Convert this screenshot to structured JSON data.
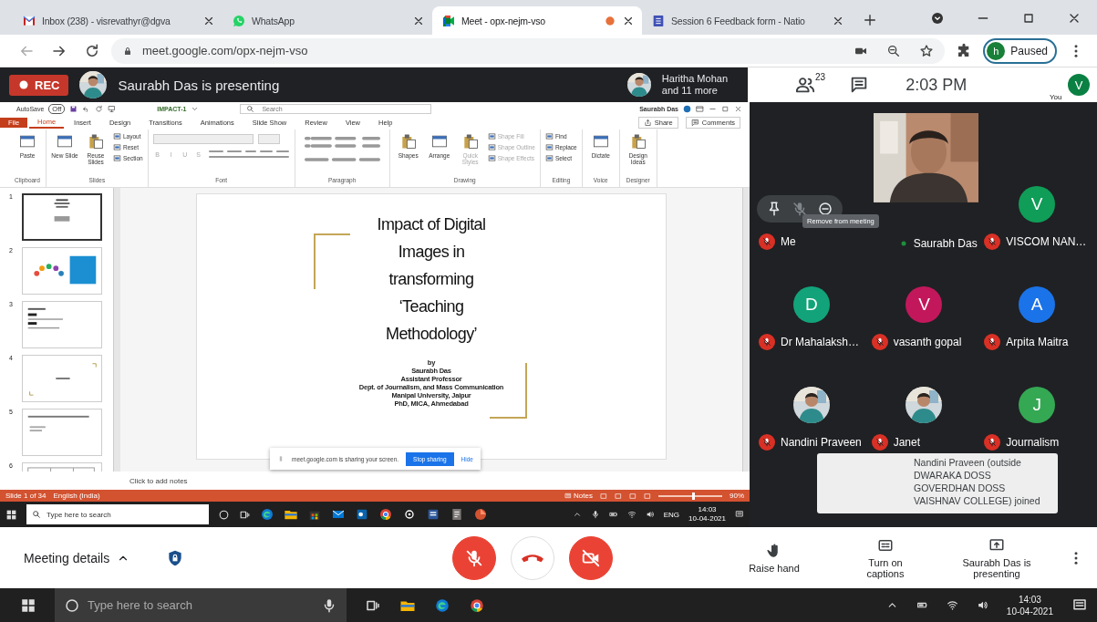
{
  "browser": {
    "tabs": [
      {
        "kind": "mail",
        "title": "Inbox (238) - visrevathyr@dgva",
        "selected": false,
        "recording": false
      },
      {
        "kind": "chat",
        "title": "WhatsApp",
        "selected": false,
        "recording": false
      },
      {
        "kind": "meet",
        "title": "Meet - opx-nejm-vso",
        "selected": true,
        "recording": true
      },
      {
        "kind": "form",
        "title": "Session 6 Feedback form - Natio",
        "selected": false,
        "recording": false
      }
    ],
    "url": "meet.google.com/opx-nejm-vso",
    "profile": {
      "initial": "h",
      "label": "Paused"
    }
  },
  "meet": {
    "rec": "REC",
    "presenter": "Saurabh Das is presenting",
    "others": [
      "Haritha Mohan",
      "and 11 more"
    ],
    "people_count": "23",
    "time": "2:03 PM",
    "self": {
      "initial": "V",
      "label": "You",
      "color": "#0b8043"
    }
  },
  "screen_share": {
    "titlebar": {
      "autosave": "AutoSave",
      "autosave_state": "Off",
      "file": "IMPACT-1",
      "search": "Search",
      "user": "Saurabh Das"
    },
    "ribbon_tabs": [
      {
        "label": "File",
        "kind": "file",
        "selected": false
      },
      {
        "label": "Home",
        "kind": "tab",
        "selected": true
      },
      {
        "label": "Insert",
        "kind": "tab",
        "selected": false
      },
      {
        "label": "Design",
        "kind": "tab",
        "selected": false
      },
      {
        "label": "Transitions",
        "kind": "tab",
        "selected": false
      },
      {
        "label": "Animations",
        "kind": "tab",
        "selected": false
      },
      {
        "label": "Slide Show",
        "kind": "tab",
        "selected": false
      },
      {
        "label": "Review",
        "kind": "tab",
        "selected": false
      },
      {
        "label": "View",
        "kind": "tab",
        "selected": false
      },
      {
        "label": "Help",
        "kind": "tab",
        "selected": false
      }
    ],
    "share": "Share",
    "comments": "Comments",
    "groups": [
      {
        "label": "Clipboard",
        "kind": "buttons",
        "buttons": [
          {
            "label": "Paste",
            "kind": "large",
            "disabled": false
          }
        ]
      },
      {
        "label": "Slides",
        "kind": "buttons",
        "buttons": [
          {
            "label": "New Slide",
            "kind": "large",
            "disabled": false
          },
          {
            "label": "Reuse Slides",
            "kind": "large",
            "disabled": false
          },
          {
            "label": "Layout",
            "kind": "small",
            "disabled": false
          },
          {
            "label": "Reset",
            "kind": "small",
            "disabled": false
          },
          {
            "label": "Section",
            "kind": "small",
            "disabled": false
          }
        ]
      },
      {
        "label": "Font",
        "kind": "font",
        "buttons": [
          {
            "label": "B",
            "kind": "format",
            "disabled": true
          },
          {
            "label": "I",
            "kind": "format",
            "disabled": true
          },
          {
            "label": "U",
            "kind": "format",
            "disabled": true
          },
          {
            "label": "S",
            "kind": "format",
            "disabled": true
          }
        ]
      },
      {
        "label": "Paragraph",
        "kind": "paragraph"
      },
      {
        "label": "Drawing",
        "kind": "buttons",
        "buttons": [
          {
            "label": "Shapes",
            "kind": "large",
            "disabled": false
          },
          {
            "label": "Arrange",
            "kind": "large",
            "disabled": false
          },
          {
            "label": "Quick Styles",
            "kind": "large",
            "disabled": true
          },
          {
            "label": "Shape Fill",
            "kind": "small",
            "disabled": true
          },
          {
            "label": "Shape Outline",
            "kind": "small",
            "disabled": true
          },
          {
            "label": "Shape Effects",
            "kind": "small",
            "disabled": true
          }
        ]
      },
      {
        "label": "Editing",
        "kind": "buttons",
        "buttons": [
          {
            "label": "Find",
            "kind": "small",
            "disabled": false
          },
          {
            "label": "Replace",
            "kind": "small",
            "disabled": false
          },
          {
            "label": "Select",
            "kind": "small",
            "disabled": false
          }
        ]
      },
      {
        "label": "Voice",
        "kind": "buttons",
        "buttons": [
          {
            "label": "Dictate",
            "kind": "large",
            "disabled": false
          }
        ]
      },
      {
        "label": "Designer",
        "kind": "buttons",
        "buttons": [
          {
            "label": "Design Ideas",
            "kind": "large",
            "disabled": false
          }
        ]
      }
    ],
    "thumbnails": [
      {
        "number": "1",
        "kind": "title",
        "selected": true
      },
      {
        "number": "2",
        "kind": "diagram",
        "selected": false
      },
      {
        "number": "3",
        "kind": "list",
        "selected": false
      },
      {
        "number": "4",
        "kind": "section",
        "selected": false
      },
      {
        "number": "5",
        "kind": "heading",
        "selected": false
      },
      {
        "number": "6",
        "kind": "table",
        "selected": false
      }
    ],
    "slide": {
      "title": "Impact of Digital Images in transforming ‘Teaching Methodology’",
      "byline": [
        "by",
        "Saurabh Das",
        "Assistant Professor",
        "Dept. of Journalism, and Mass Communication",
        "Manipal University, Jaipur",
        "PhD, MICA, Ahmedabad"
      ]
    },
    "notes": "Click to add notes",
    "share_bar": {
      "text": "meet.google.com is sharing your screen.",
      "stop": "Stop sharing",
      "hide": "Hide"
    },
    "status": {
      "slide": "Slide 1 of 34",
      "language": "English (India)",
      "notes": "Notes",
      "zoom": "90%",
      "level": 0.55
    },
    "taskbar": {
      "search": "Type here to search",
      "lang": "ENG",
      "time": "14:03",
      "date": "10-04-2021"
    }
  },
  "participants": {
    "tiles": [
      {
        "kind": "hover",
        "name": "Me",
        "muted": true
      },
      {
        "kind": "video",
        "name": "Saurabh Das",
        "muted": false
      },
      {
        "kind": "initial",
        "initial": "V",
        "color": "#0f9d58",
        "name": "VISCOM NAN…",
        "muted": true
      },
      {
        "kind": "initial",
        "initial": "D",
        "color": "#12a37a",
        "name": "Dr Mahalaksh…",
        "muted": true
      },
      {
        "kind": "initial",
        "initial": "V",
        "color": "#c2185b",
        "name": "vasanth gopal",
        "muted": true
      },
      {
        "kind": "initial",
        "initial": "A",
        "color": "#1a73e8",
        "name": "Arpita Maitra",
        "muted": true
      },
      {
        "name": "Nandini Praveen",
        "muted": true
      },
      {
        "name": "Janet",
        "muted": true
      },
      {
        "kind": "initial",
        "initial": "J",
        "color": "#34a853",
        "name": "Journalism",
        "muted": true
      }
    ],
    "tooltip": "Remove from meeting",
    "toast": "Nandini Praveen (outside DWARAKA DOSS GOVERDHAN DOSS VAISHNAV COLLEGE) joined"
  },
  "controls": {
    "meeting_details": "Meeting details",
    "mic_on": false,
    "camera_on": false,
    "actions": [
      {
        "kind": "hand",
        "label": "Raise hand"
      },
      {
        "kind": "captions",
        "label": "Turn on captions"
      },
      {
        "kind": "present",
        "label": "Saurabh Das is presenting"
      }
    ]
  },
  "taskbar": {
    "search": "Type here to search",
    "time": "14:03",
    "date": "10-04-2021"
  }
}
